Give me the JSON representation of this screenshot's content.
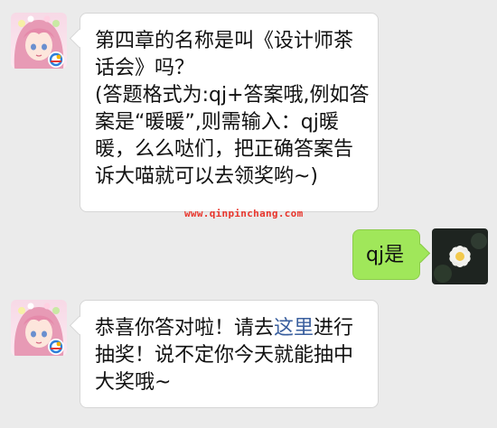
{
  "messages": [
    {
      "side": "left",
      "lines": [
        "第四章的名称是叫《设计师茶",
        "话会》吗？",
        "(答题格式为:qj+答案哦,例如答",
        "案是“暖暖”,则需输入：qj暖",
        "暖，么么哒们，把正确答案告",
        "诉大喵就可以去领奖哟~)"
      ]
    },
    {
      "side": "right",
      "text": "qj是"
    },
    {
      "side": "left",
      "line1_before": "恭喜你答对啦！请去",
      "line1_link": "这里",
      "line1_after": "进行",
      "line2": "抽奖！说不定你今天就能抽中",
      "line3": "大奖哦~"
    }
  ],
  "watermark": "www.qinpinchang.com",
  "colors": {
    "background": "#ebebeb",
    "sent_bubble": "#a0e75a",
    "received_bubble": "#ffffff",
    "link": "#3a5f9e",
    "watermark": "#e8352c"
  },
  "icons": {
    "bot_avatar": "anime-girl-avatar-icon",
    "badge": "game-logo-icon",
    "user_avatar": "white-flower-avatar-icon"
  }
}
